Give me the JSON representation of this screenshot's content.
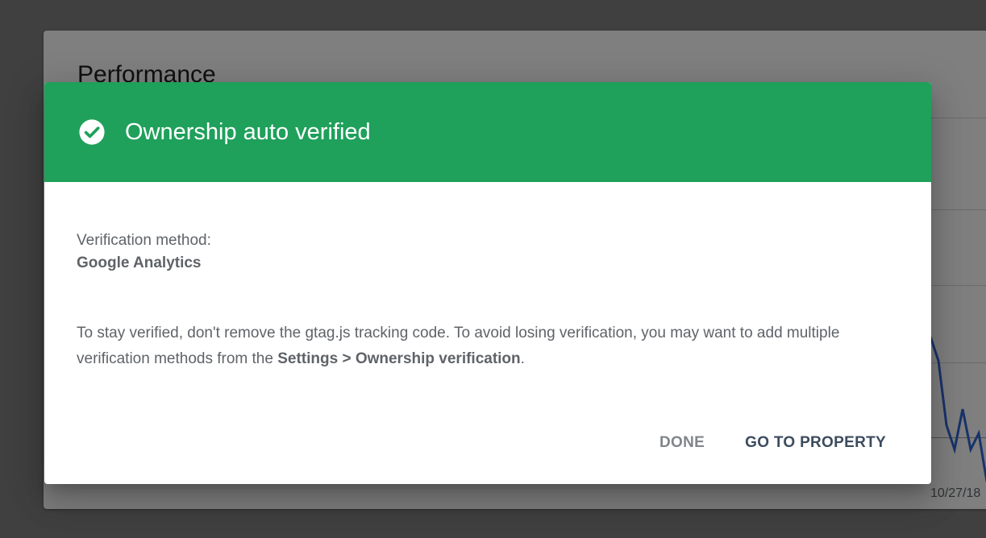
{
  "background": {
    "card_title": "Performance",
    "date_label": "10/27/18"
  },
  "dialog": {
    "title": "Ownership auto verified",
    "icon": "check-circle-icon",
    "method_label": "Verification method:",
    "method_value": "Google Analytics",
    "message_part1": "To stay verified, don't remove the gtag.js tracking code. To avoid losing verification, you may want to add multiple verification methods from the ",
    "message_link": "Settings > Ownership verification",
    "message_part2": ".",
    "done_label": "DONE",
    "go_label": "GO TO PROPERTY"
  },
  "colors": {
    "header_green": "#1fa05b",
    "scrim": "#808080",
    "chart_line": "#3367d6"
  }
}
